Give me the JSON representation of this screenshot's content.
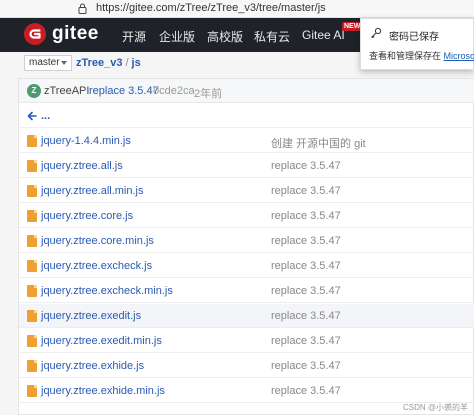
{
  "browser": {
    "url": "https://gitee.com/zTree/zTree_v3/tree/master/js"
  },
  "nav": {
    "logo_text": "gitee",
    "items": [
      "开源",
      "企业版",
      "高校版",
      "私有云",
      "Gitee AI"
    ],
    "badge": "NEW"
  },
  "popup": {
    "title": "密码已保存",
    "desc": "查看和管理保存在",
    "link": "Microsoft 密"
  },
  "branch": {
    "name": "master",
    "crumb_repo": "zTree_v3",
    "crumb_sep": "/",
    "crumb_dir": "js"
  },
  "commit": {
    "avatar_letter": "Z",
    "author": "zTreeAPI",
    "message": "replace 3.5.47",
    "hash": "0cde2ca",
    "time": "2年前"
  },
  "parent_dir": "...",
  "files": [
    {
      "name": "jquery-1.4.4.min.js",
      "commit": "创建 开源中国的 git"
    },
    {
      "name": "jquery.ztree.all.js",
      "commit": "replace 3.5.47"
    },
    {
      "name": "jquery.ztree.all.min.js",
      "commit": "replace 3.5.47"
    },
    {
      "name": "jquery.ztree.core.js",
      "commit": "replace 3.5.47"
    },
    {
      "name": "jquery.ztree.core.min.js",
      "commit": "replace 3.5.47"
    },
    {
      "name": "jquery.ztree.excheck.js",
      "commit": "replace 3.5.47"
    },
    {
      "name": "jquery.ztree.excheck.min.js",
      "commit": "replace 3.5.47"
    },
    {
      "name": "jquery.ztree.exedit.js",
      "commit": "replace 3.5.47"
    },
    {
      "name": "jquery.ztree.exedit.min.js",
      "commit": "replace 3.5.47"
    },
    {
      "name": "jquery.ztree.exhide.js",
      "commit": "replace 3.5.47"
    },
    {
      "name": "jquery.ztree.exhide.min.js",
      "commit": "replace 3.5.47"
    }
  ],
  "watermark": "CSDN @小裘的羊"
}
